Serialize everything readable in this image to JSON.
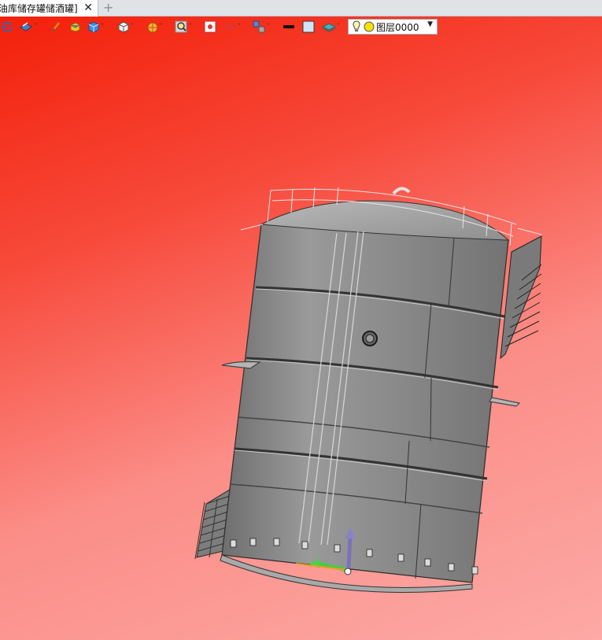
{
  "document_tab": {
    "title": "油库储存罐储酒罐]",
    "close_glyph": "✕",
    "add_glyph": "+"
  },
  "toolbar": {
    "tools": [
      "view-orient-icon",
      "render-mode-icon",
      "pen-icon",
      "box-yellow-icon",
      "cube-blue-icon",
      "cube-white-icon",
      "section-icon",
      "zoom-icon",
      "snapshot-icon",
      "measure-icon",
      "arrange-icon",
      "line-style-icon",
      "color-swatch-icon",
      "layer-stack-icon"
    ],
    "layer_select": {
      "value": "图层0000"
    }
  },
  "colors": {
    "viewport_top": "#f3200a",
    "viewport_bottom": "#fda9a5",
    "tank_body": "#8e8e8e"
  }
}
